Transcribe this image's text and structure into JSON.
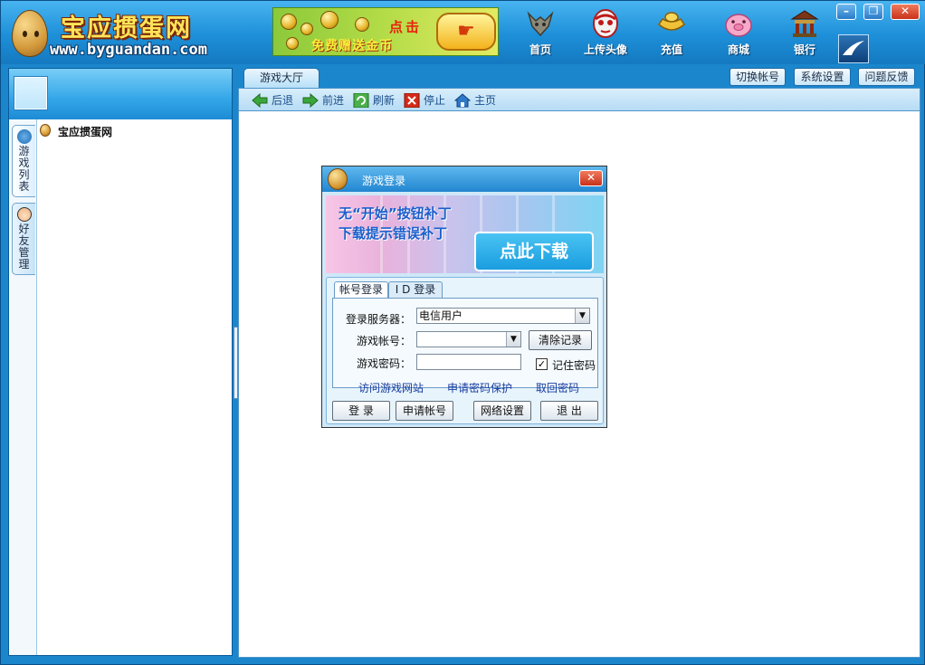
{
  "app": {
    "logo_title": "宝应掼蛋网",
    "logo_url": "www.byguandan.com"
  },
  "banner": {
    "text_click": "点击",
    "text_free": "免费赠送金币"
  },
  "nav": {
    "home": "首页",
    "upload_avatar": "上传头像",
    "recharge": "充值",
    "mall": "商城",
    "bank": "银行"
  },
  "window_controls": {
    "minimize": "–",
    "maximize": "❐",
    "close": "✕"
  },
  "sidebar": {
    "tabs": [
      "游戏列表",
      "好友管理"
    ],
    "tree_root": "宝应掼蛋网"
  },
  "main": {
    "tab_lobby": "游戏大厅",
    "top_buttons": {
      "switch_account": "切换帐号",
      "system_settings": "系统设置",
      "feedback": "问题反馈"
    },
    "toolbar": {
      "back": "后退",
      "forward": "前进",
      "refresh": "刷新",
      "stop": "停止",
      "home": "主页"
    }
  },
  "login_dialog": {
    "title": "游戏登录",
    "ad_line1": "无“开始”按钮补丁",
    "ad_line2": "下载提示错误补丁",
    "ad_button": "点此下载",
    "tab_account": "帐号登录",
    "tab_id": "I D 登录",
    "server_label": "登录服务器：",
    "server_value": "电信用户",
    "account_label": "游戏帐号：",
    "account_value": "",
    "clear_button": "清除记录",
    "password_label": "游戏密码：",
    "password_value": "",
    "remember_label": "记住密码",
    "remember_checked": true,
    "links": {
      "visit_site": "访问游戏网站",
      "apply_protection": "申请密码保护",
      "recover_password": "取回密码"
    },
    "buttons": {
      "login": "登 录",
      "register": "申请帐号",
      "network": "网络设置",
      "exit": "退 出"
    }
  },
  "colors": {
    "frame_blue": "#1b86cc",
    "title_yellow": "#ffe45a",
    "close_red": "#c8321a",
    "link_blue": "#1a3da0"
  }
}
